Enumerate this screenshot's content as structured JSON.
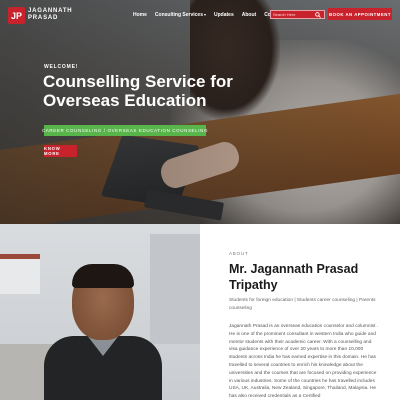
{
  "brand": {
    "mark": "JP",
    "name_line1": "JAGANNATH",
    "name_line2": "PRASAD"
  },
  "nav": {
    "items": [
      {
        "label": "Home",
        "active": true
      },
      {
        "label": "Consulting Services",
        "dropdown": true
      },
      {
        "label": "Updates"
      },
      {
        "label": "About"
      },
      {
        "label": "Contact"
      }
    ],
    "search_placeholder": "Search Here",
    "book_button": "BOOK AN APPOINTMENT",
    "caret": "▾"
  },
  "hero": {
    "welcome": "WELCOME!",
    "title": "Counselling Service for Overseas Education",
    "tagline": "CAREER COUNSELING / OVERSEAS EDUCATION COUNSELING",
    "cta": "KNOW MORE"
  },
  "about": {
    "label": "ABOUT",
    "name": "Mr. Jagannath Prasad Tripathy",
    "subtitle": "Students for foreign education | Students career counseling | Parents counseling",
    "body": "Jagannath Prasad is an overseas education counselor and columnist . He is one of the prominent consultant in western India who guide and mentor students with their academic career. With a counselling and visa guidance experience of over 20 years to more than 10,000 students across India he has earned expertise in this domain. He has travelled to several countries to enrich his knowledge about the universities and the courses that are focused on providing experience in various industries. Some of the countries he has travelled includes USA, UK, Australia, New Zealand, Singapore, Thailand, Malaysia. He has also received credentials as a Certified"
  },
  "colors": {
    "brand_red": "#c8232c",
    "accent_green": "#58b54a"
  }
}
